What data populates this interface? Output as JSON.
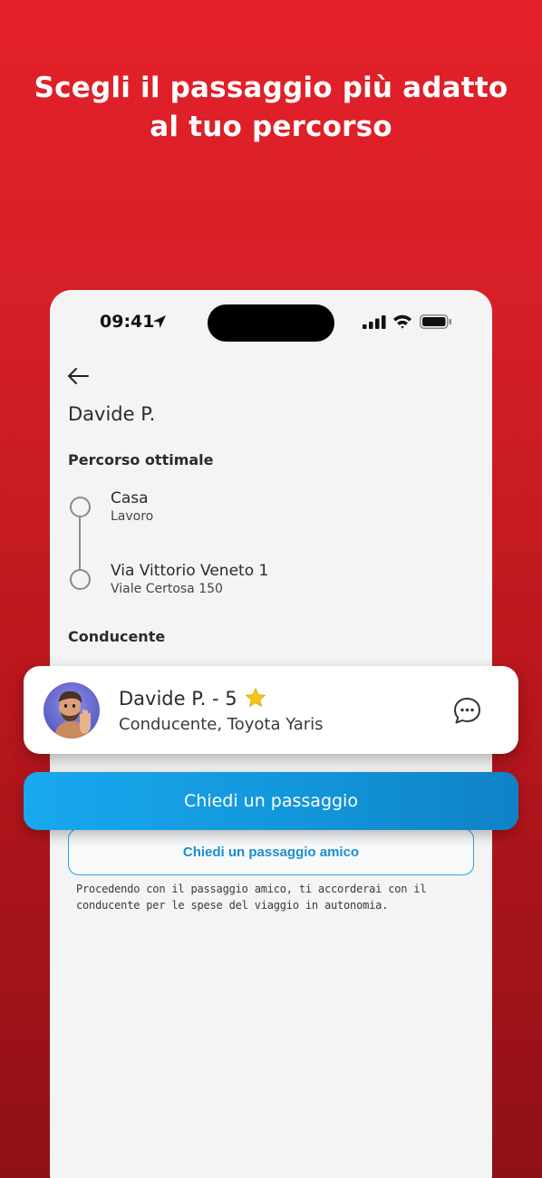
{
  "headline": {
    "line1": "Scegli il passaggio più adatto",
    "line2": "al tuo percorso"
  },
  "status_bar": {
    "time": "09:41",
    "icons": [
      "location-arrow-icon",
      "signal-icon",
      "wifi-icon",
      "battery-icon"
    ]
  },
  "screen": {
    "back_icon": "arrow-left-icon",
    "title": "Davide P.",
    "route_section_label": "Percorso ottimale",
    "stops": [
      {
        "main": "Casa",
        "sub": "Lavoro"
      },
      {
        "main": "Via Vittorio Veneto 1",
        "sub": "Viale Certosa 150"
      }
    ],
    "driver_section_label": "Conducente"
  },
  "driver_card": {
    "name_rating": "Davide P. - 5",
    "rating_icon": "star-icon",
    "subtitle": "Conducente, Toyota Yaris",
    "chat_icon": "chat-bubble-icon"
  },
  "actions": {
    "primary_label": "Chiedi un passaggio",
    "secondary_label": "Chiedi un passaggio amico",
    "disclaimer": "Procedendo con il passaggio amico, ti accorderai con il conducente per le spese del viaggio in autonomia."
  },
  "colors": {
    "background_top": "#e42128",
    "background_bottom": "#8e1116",
    "primary_button": "#1396db",
    "secondary_border": "#2aa5dd",
    "star": "#f5c518"
  }
}
